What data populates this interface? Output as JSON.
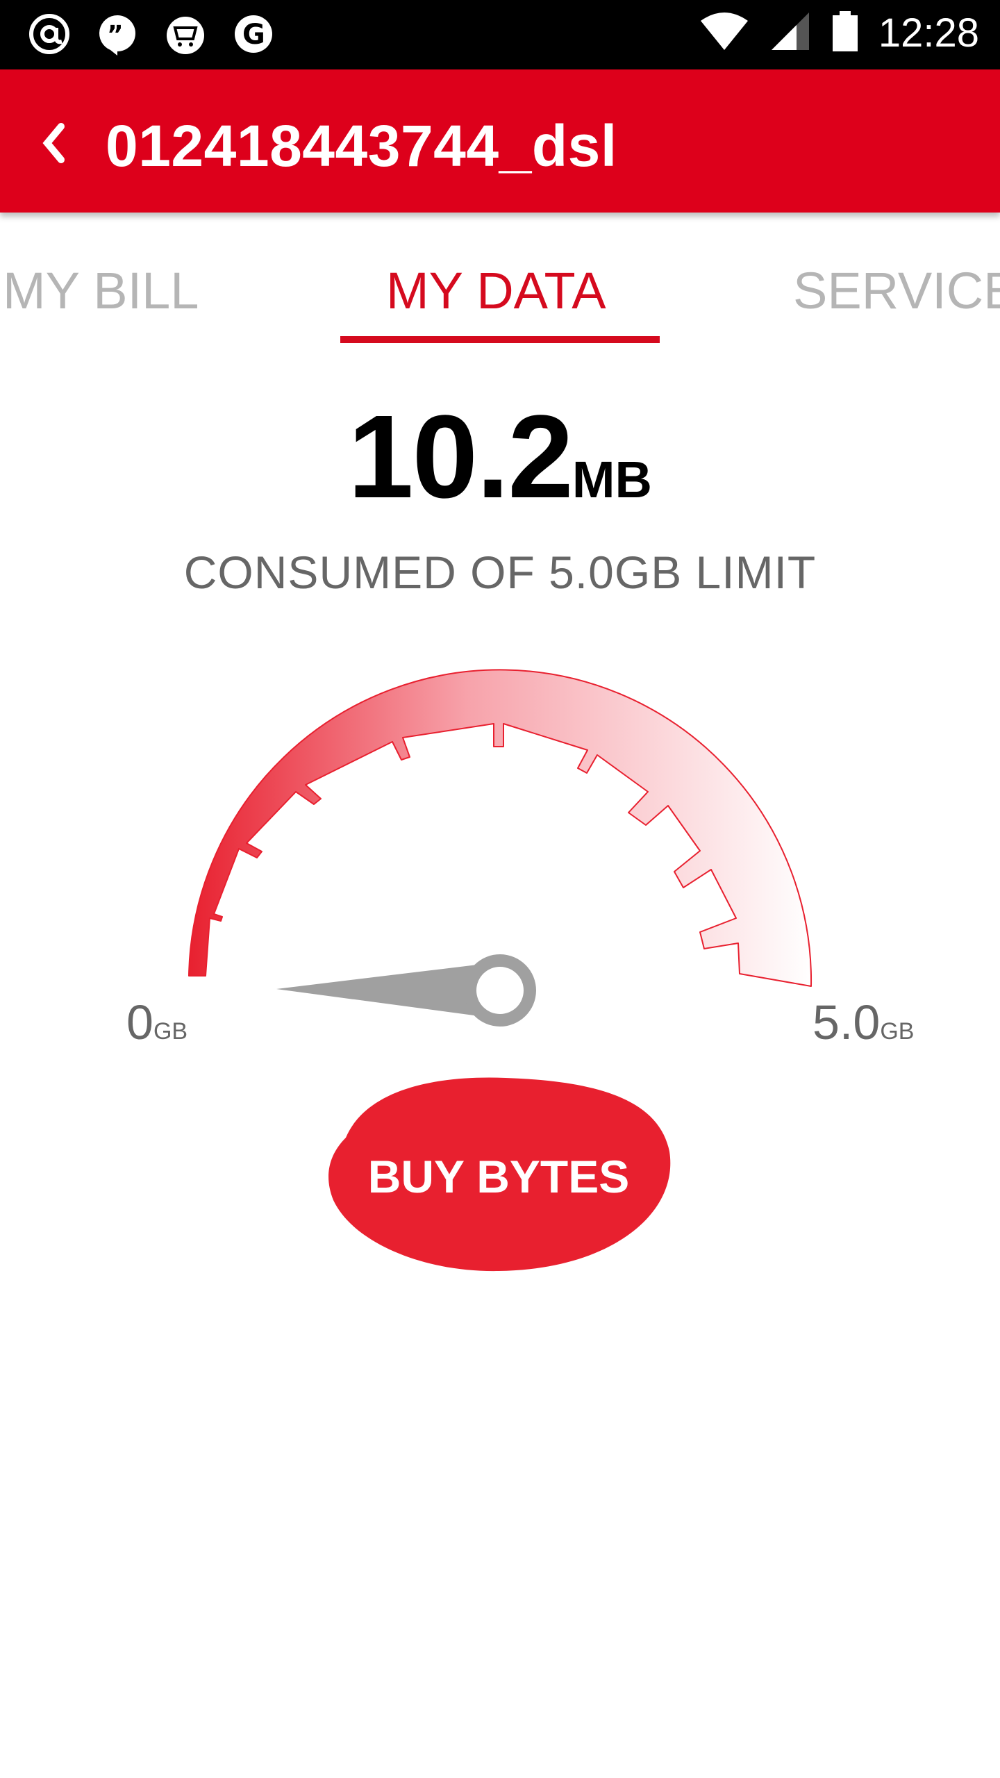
{
  "status_bar": {
    "time": "12:28",
    "left_icons": [
      "at-sign-icon",
      "quote-bubble-icon",
      "shopping-cart-icon",
      "g-logo-icon"
    ],
    "right_icons": [
      "wifi-icon",
      "signal-icon",
      "battery-icon"
    ]
  },
  "app_bar": {
    "title": "012418443744_dsl",
    "back_icon": "chevron-left-icon",
    "color": "#dd001b"
  },
  "tabs": [
    {
      "label": "MY BILL",
      "active": false
    },
    {
      "label": "MY DATA",
      "active": true
    },
    {
      "label": "SERVICE",
      "active": false
    }
  ],
  "usage": {
    "value": "10.2",
    "unit": "MB",
    "caption": "CONSUMED OF 5.0GB LIMIT"
  },
  "gauge": {
    "min_value": "0",
    "min_unit": "GB",
    "max_value": "5.0",
    "max_unit": "GB",
    "consumed_fraction": 0.002,
    "accent_color": "#e8202f",
    "needle_color": "#a0a0a0"
  },
  "actions": {
    "buy_label": "BUY BYTES",
    "buy_color": "#e8202f"
  }
}
